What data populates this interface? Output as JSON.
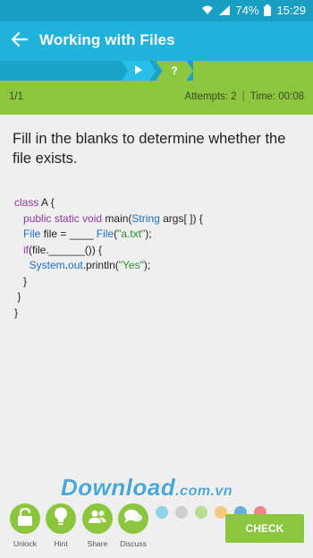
{
  "status_bar": {
    "battery": "74%",
    "time": "15:29"
  },
  "app_bar": {
    "title": "Working with Files"
  },
  "progress": {
    "current_step": "?"
  },
  "info": {
    "count": "1/1",
    "attempts": "Attempts: 2",
    "time": "Time: 00:08"
  },
  "question": "Fill in the blanks to determine whether the file exists.",
  "code": {
    "l1_kw": "class",
    "l1_rest": " A {",
    "l2_kw": "public static void",
    "l2_a": " main(",
    "l2_ty": "String",
    "l2_b": " args[ ]) {",
    "l3_ty": "File",
    "l3_a": " file = ____ ",
    "l3_ty2": "File",
    "l3_b": "(",
    "l3_str": "\"a.txt\"",
    "l3_c": ");",
    "l4_kw": "if",
    "l4_rest": "(file.______()) {",
    "l5_ty": "System",
    "l5_a": ".",
    "l5_ty2": "out",
    "l5_b": ".println(",
    "l5_str": "\"Yes\"",
    "l5_c": ");",
    "l6": "}",
    "l7": "}",
    "l8": "}"
  },
  "watermark": {
    "main": "Download",
    "suffix": ".com.vn"
  },
  "dot_colors": [
    "#8fd3ea",
    "#cfcfcf",
    "#b7de8c",
    "#f5c97f",
    "#6aaee0",
    "#f08585"
  ],
  "actions": [
    {
      "label": "Unlock",
      "icon": "lock-icon"
    },
    {
      "label": "Hint",
      "icon": "bulb-icon"
    },
    {
      "label": "Share",
      "icon": "people-icon"
    },
    {
      "label": "Discuss",
      "icon": "chat-icon"
    }
  ],
  "check_label": "CHECK",
  "colors": {
    "accent": "#21b3dc",
    "green": "#8cc63f"
  }
}
